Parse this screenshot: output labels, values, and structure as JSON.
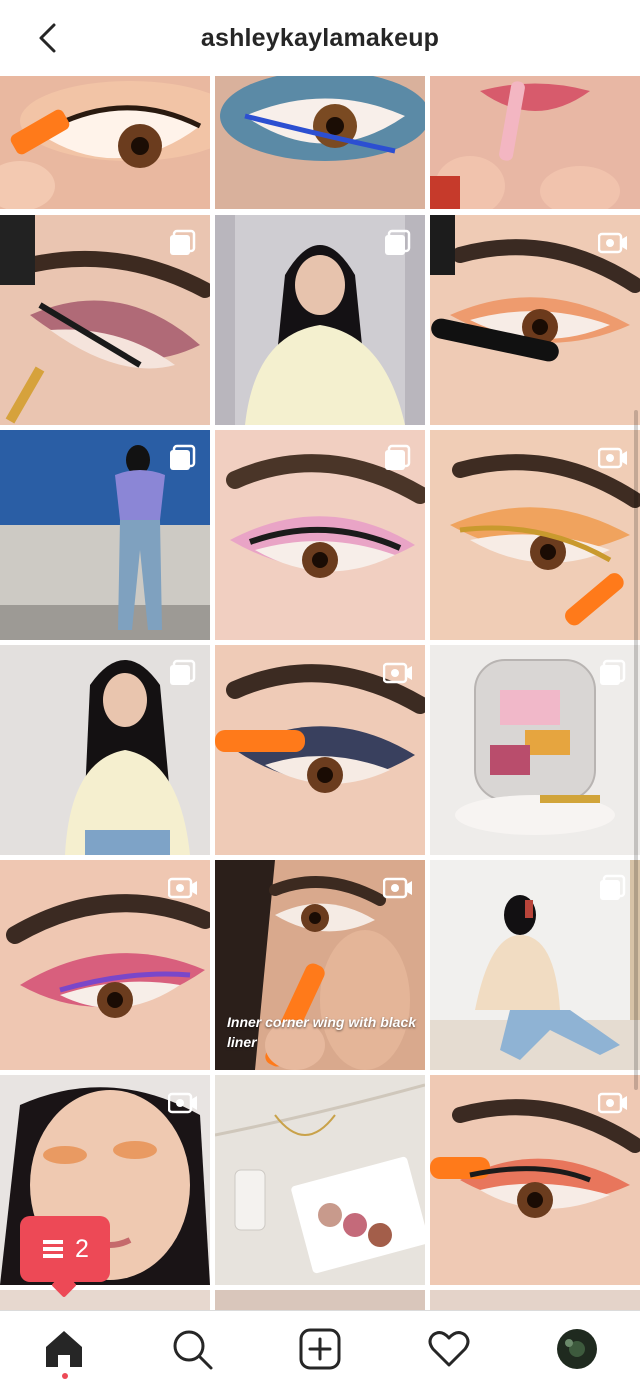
{
  "header": {
    "title": "ashleykaylamakeup",
    "back_icon": "chevron-left-icon"
  },
  "grid": {
    "tiles": [
      {
        "name": "post-eye-orange-pen",
        "badge": ""
      },
      {
        "name": "post-eye-blue-liner",
        "badge": ""
      },
      {
        "name": "post-lip-gloss",
        "badge": ""
      },
      {
        "name": "post-eye-mauve-wing",
        "badge": "carousel-icon"
      },
      {
        "name": "post-portrait-white-sweater",
        "badge": "carousel-icon"
      },
      {
        "name": "post-eye-mascara",
        "badge": "video-icon"
      },
      {
        "name": "post-outfit-blue-wall",
        "badge": "carousel-icon"
      },
      {
        "name": "post-eye-pink-lashes",
        "badge": "carousel-icon"
      },
      {
        "name": "post-eye-gold-liner",
        "badge": "video-icon"
      },
      {
        "name": "post-portrait-yellow-top",
        "badge": "carousel-icon"
      },
      {
        "name": "post-eye-blue-glitter",
        "badge": "video-icon"
      },
      {
        "name": "post-morphe-bag",
        "badge": "carousel-icon"
      },
      {
        "name": "post-eye-sunset-purple",
        "badge": "video-icon"
      },
      {
        "name": "post-inner-corner-wing",
        "badge": "video-icon",
        "caption": "Inner corner wing with black liner"
      },
      {
        "name": "post-portrait-mirror-selfie",
        "badge": "carousel-icon"
      },
      {
        "name": "post-portrait-orange-glam",
        "badge": "video-icon"
      },
      {
        "name": "post-palette-flatlay",
        "badge": ""
      },
      {
        "name": "post-eye-orange-wing",
        "badge": "video-icon"
      }
    ]
  },
  "notification": {
    "count": "2",
    "icon": "activity-list-icon"
  },
  "navbar": {
    "items": [
      "home-icon",
      "search-icon",
      "new-post-icon",
      "heart-icon",
      "profile-avatar"
    ]
  },
  "colors": {
    "accent": "#ed4956",
    "text": "#262626",
    "border": "#dbdbdb"
  }
}
